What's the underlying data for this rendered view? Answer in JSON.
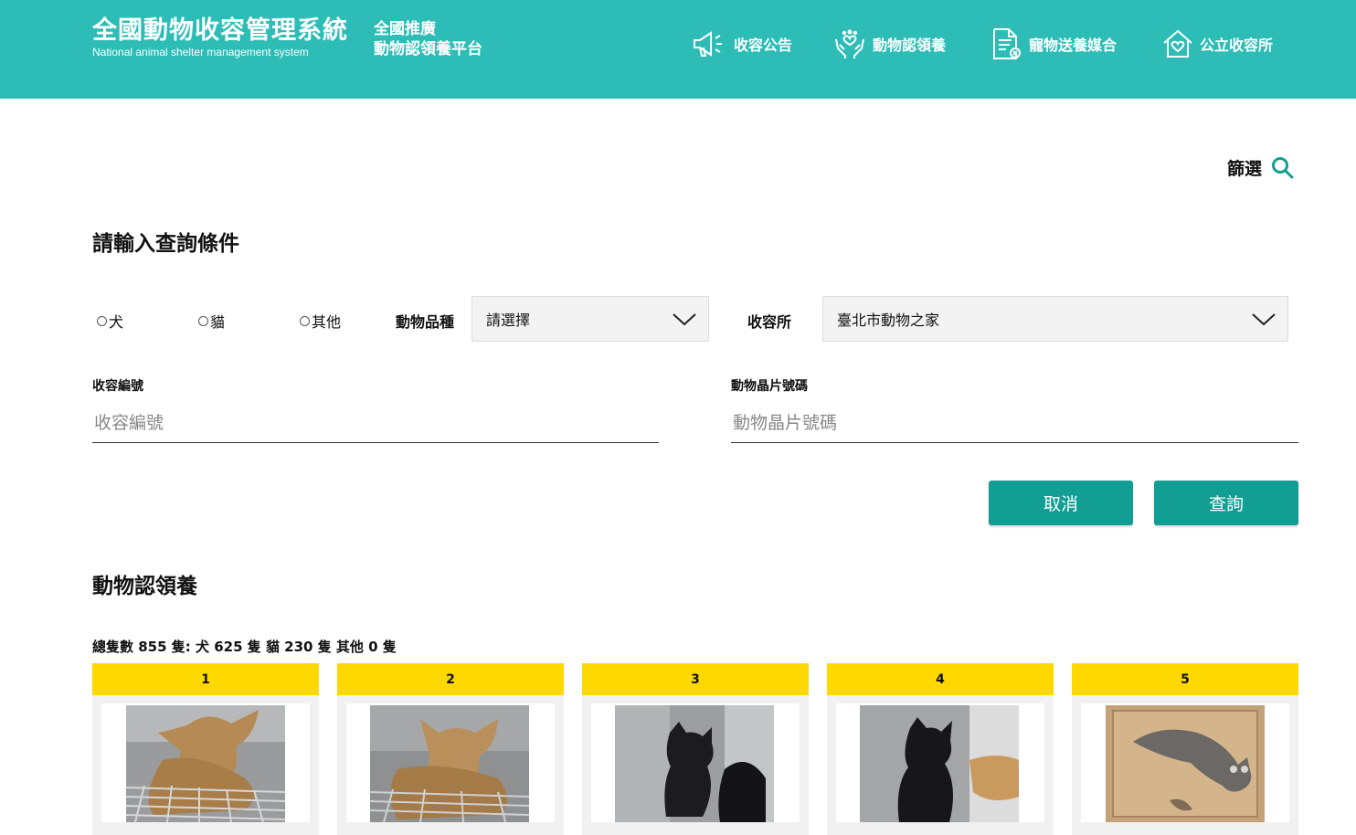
{
  "header": {
    "title": "全國動物收容管理系統",
    "subtitle": "National animal shelter management system",
    "platform_line1": "全國推廣",
    "platform_line2": "動物認領養平台",
    "nav": [
      {
        "label": "收容公告",
        "icon": "megaphone-icon"
      },
      {
        "label": "動物認領養",
        "icon": "hands-heart-icon"
      },
      {
        "label": "寵物送養媒合",
        "icon": "document-icon"
      },
      {
        "label": "公立收容所",
        "icon": "house-heart-icon"
      }
    ]
  },
  "filter": {
    "label": "篩選",
    "icon": "search-icon"
  },
  "query": {
    "heading": "請輸入查詢條件",
    "species": [
      "犬",
      "貓",
      "其他"
    ],
    "breed_label": "動物品種",
    "breed_value": "請選擇",
    "shelter_label": "收容所",
    "shelter_value": "臺北市動物之家",
    "shelter_no_label": "收容編號",
    "shelter_no_placeholder": "收容編號",
    "chip_label": "動物晶片號碼",
    "chip_placeholder": "動物晶片號碼",
    "cancel_label": "取消",
    "search_label": "查詢"
  },
  "results": {
    "heading": "動物認領養",
    "summary": "總隻數 855 隻:  犬 625 隻 貓 230 隻 其他 0 隻",
    "cards": [
      {
        "num": "1",
        "image": "tan-dog-photo"
      },
      {
        "num": "2",
        "image": "tan-dog-photo"
      },
      {
        "num": "3",
        "image": "black-dog-photo"
      },
      {
        "num": "4",
        "image": "black-dog-photo"
      },
      {
        "num": "5",
        "image": "tabby-cat-photo"
      }
    ]
  },
  "colors": {
    "header_bg": "#2dbdb6",
    "button_bg": "#129e93",
    "card_header": "#ffd800"
  }
}
